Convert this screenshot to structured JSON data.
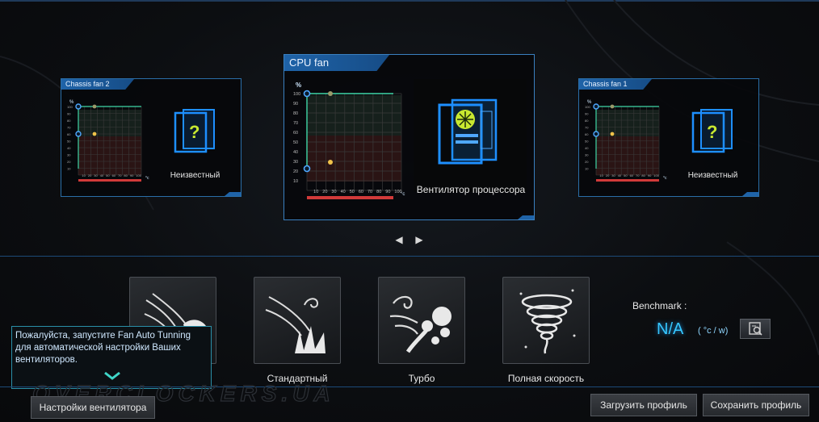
{
  "fans": {
    "left": {
      "title": "Chassis fan 2",
      "status": "Неизвестный",
      "icon": "unknown-case-icon"
    },
    "center": {
      "title": "CPU fan",
      "status": "Вентилятор процессора",
      "icon": "cpu-fan-case-icon"
    },
    "right": {
      "title": "Chassis fan 1",
      "status": "Неизвестный",
      "icon": "unknown-case-icon"
    }
  },
  "graph": {
    "y_unit": "%",
    "x_unit": "°c",
    "y_ticks": [
      "100",
      "90",
      "80",
      "70",
      "60",
      "50",
      "40",
      "30",
      "20",
      "10"
    ],
    "x_ticks": [
      "10",
      "20",
      "30",
      "40",
      "50",
      "60",
      "70",
      "80",
      "90",
      "100"
    ]
  },
  "modes": [
    {
      "label": "",
      "icon": "silent-mode-icon"
    },
    {
      "label": "Стандартный",
      "icon": "standard-mode-icon"
    },
    {
      "label": "Турбо",
      "icon": "turbo-mode-icon"
    },
    {
      "label": "Полная скорость",
      "icon": "full-speed-mode-icon"
    }
  ],
  "benchmark": {
    "label": "Benchmark :",
    "value": "N/A",
    "unit": "( °c / w)",
    "icon": "search-chart-icon"
  },
  "tooltip": {
    "text": "Пожалуйста, запустите Fan Auto Tunning для автоматической настройки Ваших вентиляторов."
  },
  "buttons": {
    "fan_settings": "Настройки вентилятора",
    "load_profile": "Загрузить профиль",
    "save_profile": "Сохранить профиль"
  },
  "watermark": "OVERCLOCKERS.UA",
  "colors": {
    "accent": "#2a6ea8",
    "graph_line": "#3fd6a6",
    "graph_bar": "#d23a3a",
    "point_blue": "#4fa8ff",
    "point_yellow": "#f0c24a",
    "benchmark": "#36c7ff"
  }
}
